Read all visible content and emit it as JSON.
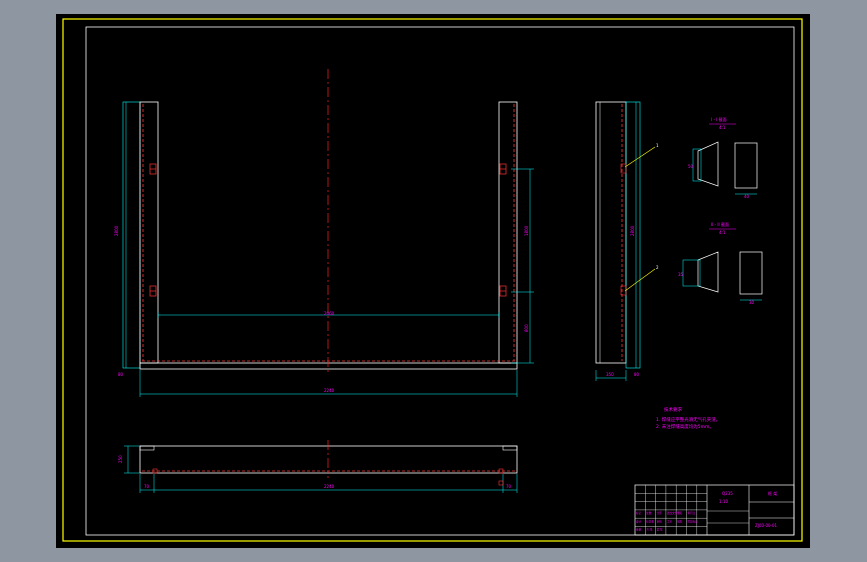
{
  "drawing": {
    "colors": {
      "viewport_bg": "#8d96a1",
      "paper": "#000000",
      "border_outer": "#ffff00",
      "border_inner": "#ffffff",
      "geometry": "#ffffff",
      "dimension": "#00ffff",
      "hidden": "#ff3333",
      "centerline": "#ff2020",
      "annotation": "#ff00ff",
      "leader": "#ffff00"
    },
    "dimensions": {
      "main_overall_width": "2240",
      "main_inner_width": "2060",
      "main_left_height": "2800",
      "main_right_upper": "1800",
      "main_right_lower": "800",
      "main_base": "80",
      "bottom_overall_width": "2240",
      "bottom_height": "250",
      "bottom_left": "70",
      "bottom_right": "70",
      "side_height": "2800",
      "side_width": "350",
      "side_base": "80"
    },
    "section_views": [
      {
        "label": "I - I 截面",
        "scale": "4:1",
        "dim_a": "50",
        "dim_b": "40"
      },
      {
        "label": "II - II 截面",
        "scale": "4:1",
        "dim_a": "35",
        "dim_b": "30"
      }
    ],
    "leaders": [
      "1",
      "2"
    ],
    "tech_notes": {
      "title": "技术要求",
      "lines": [
        "1. 焊缝应平整光滑无气孔夹渣。",
        "2. 未注焊缝高度均为5mm。"
      ]
    },
    "title_block": {
      "scale_label": "比例",
      "scale_value": "1:10",
      "material": "Q235",
      "name": "框 架",
      "drawing_no": "ZJ00-00-01",
      "labels": [
        "标记",
        "处数",
        "分区",
        "更改文件号",
        "签名",
        "年月日",
        "设计",
        "标准化",
        "审核",
        "工艺",
        "批准",
        "阶段标记",
        "重量",
        "共 张",
        "第 张"
      ]
    }
  }
}
